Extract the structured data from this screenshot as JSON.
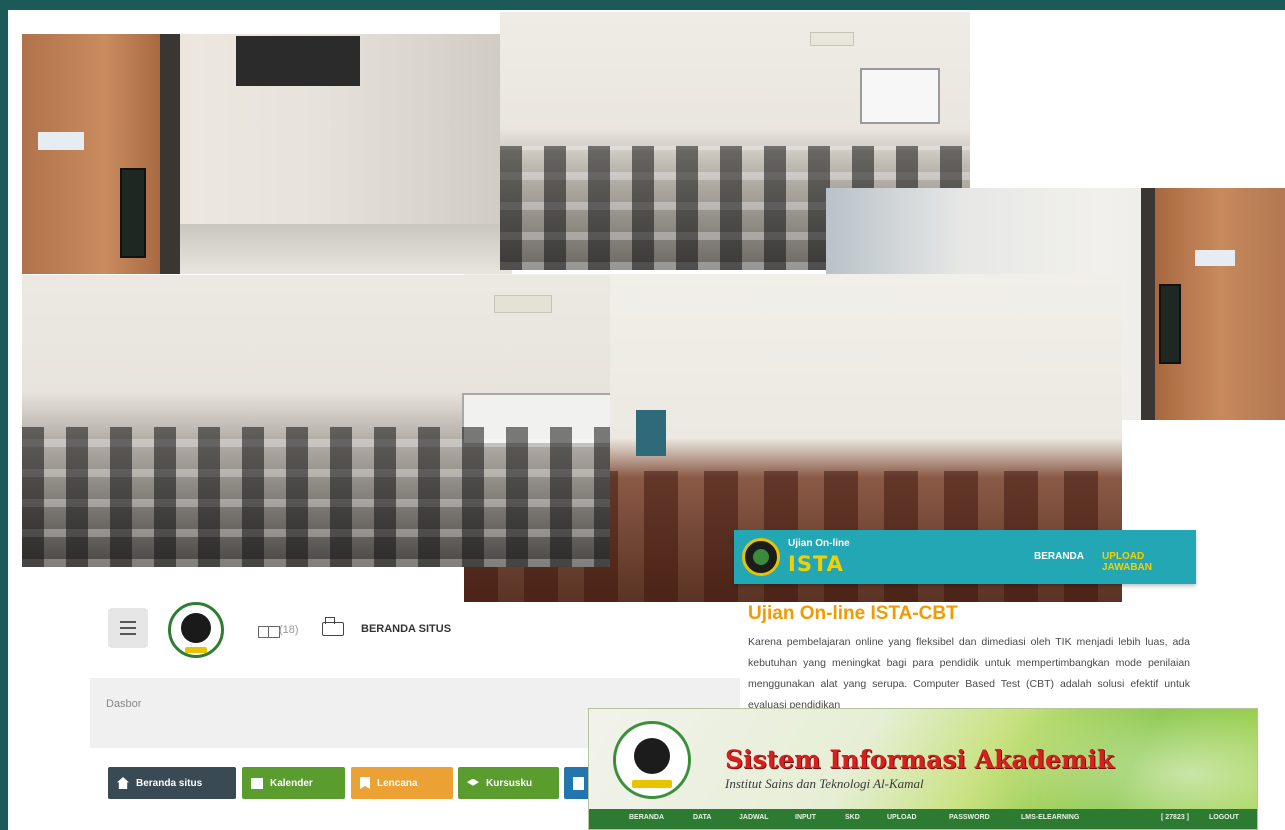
{
  "cbt": {
    "brand_small": "Ujian On-line",
    "brand_big": "ISTA",
    "nav": [
      "BERANDA",
      "UPLOAD JAWABAN"
    ],
    "title": "Ujian On-line ISTA-CBT",
    "paragraph": "Karena pembelajaran online yang fleksibel dan dimediasi oleh TIK menjadi lebih luas, ada kebutuhan yang meningkat bagi para pendidik untuk mempertimbangkan mode penilaian menggunakan alat yang serupa. Computer Based Test (CBT) adalah solusi efektif untuk evaluasi pendidikan"
  },
  "moodle": {
    "grid_count": "(18)",
    "site_home": "BERANDA SITUS",
    "breadcrumb": "Dasbor",
    "buttons": [
      "Beranda situs",
      "Kalender",
      "Lencana",
      "Kursusku"
    ]
  },
  "siakad": {
    "title": "Sistem Informasi Akademik",
    "subtitle": "Institut Sains dan Teknologi Al-Kamal",
    "nav": [
      "BERANDA",
      "DATA",
      "JADWAL",
      "INPUT",
      "SKD",
      "UPLOAD",
      "PASSWORD",
      "LMS-ELEARNING"
    ],
    "user": "[ 27823 ]",
    "logout": "LOGOUT"
  },
  "colors": {
    "background": "#1c5a5a",
    "cbt_header": "#23a7b5",
    "cbt_title": "#f29a00",
    "siakad_title": "#d61f1f",
    "siakad_nav": "#2d7a32"
  }
}
